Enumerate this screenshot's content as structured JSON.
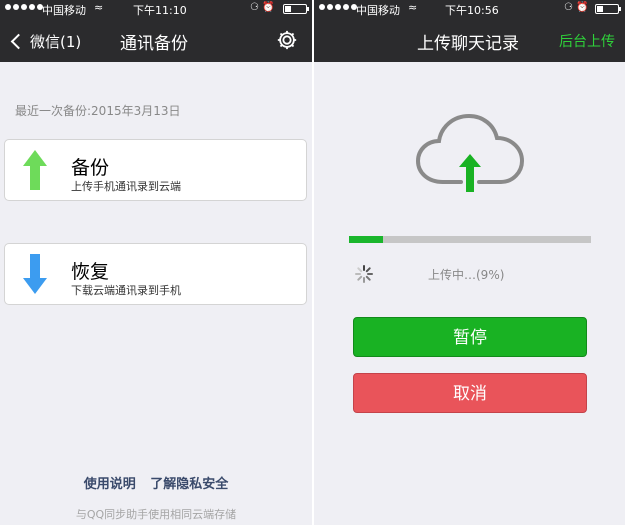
{
  "colors": {
    "accent_green": "#19b223",
    "danger_red": "#e9545a",
    "navbar": "#2b2b2d",
    "background": "#efeff4"
  },
  "left": {
    "status": {
      "carrier": "中国移动",
      "time": "下午11:10"
    },
    "nav": {
      "back_label": "微信(1)",
      "title": "通讯备份",
      "settings_icon": "gear-icon"
    },
    "last_backup": "最近一次备份:2015年3月13日",
    "backup": {
      "title": "备份",
      "subtitle": "上传手机通讯录到云端",
      "icon": "up-arrow-icon"
    },
    "restore": {
      "title": "恢复",
      "subtitle": "下载云端通讯录到手机",
      "icon": "down-arrow-icon"
    },
    "links": {
      "instructions": "使用说明",
      "privacy": "了解隐私安全"
    },
    "footer": "与QQ同步助手使用相同云端存储"
  },
  "right": {
    "status": {
      "carrier": "中国移动",
      "time": "下午10:56"
    },
    "nav": {
      "title": "上传聊天记录",
      "background_upload": "后台上传"
    },
    "progress": {
      "fraction": 0.14,
      "status_text": "上传中…(9%)"
    },
    "buttons": {
      "pause": "暂停",
      "cancel": "取消"
    }
  }
}
